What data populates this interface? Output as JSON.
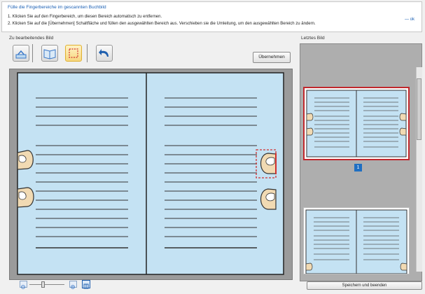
{
  "instructions": {
    "title": "Fülle die Fingerbereiche im gescannten Buchbild",
    "step1": "1. Klicken Sie auf den Fingerbereich, um diesen Bereich automatisch zu entfernen.",
    "step2": "2. Klicken Sie auf die [Übernehmen] Schaltfläche und füllen den ausgewählten Bereich aus. Verschieben sie die Umleitung, um den ausgewählten Bereich zu ändern.",
    "more": "— ok"
  },
  "left_panel": {
    "label": "Zu bearbeitendes Bild",
    "apply_label": "Übernehmen"
  },
  "right_panel": {
    "label": "Letztes Bild",
    "page_number": "1"
  },
  "footer": {
    "save_label": "Speichern und beenden"
  },
  "colors": {
    "page": "#c4e2f3",
    "accent": "#1f6fc2",
    "selection": "#c0282d"
  }
}
